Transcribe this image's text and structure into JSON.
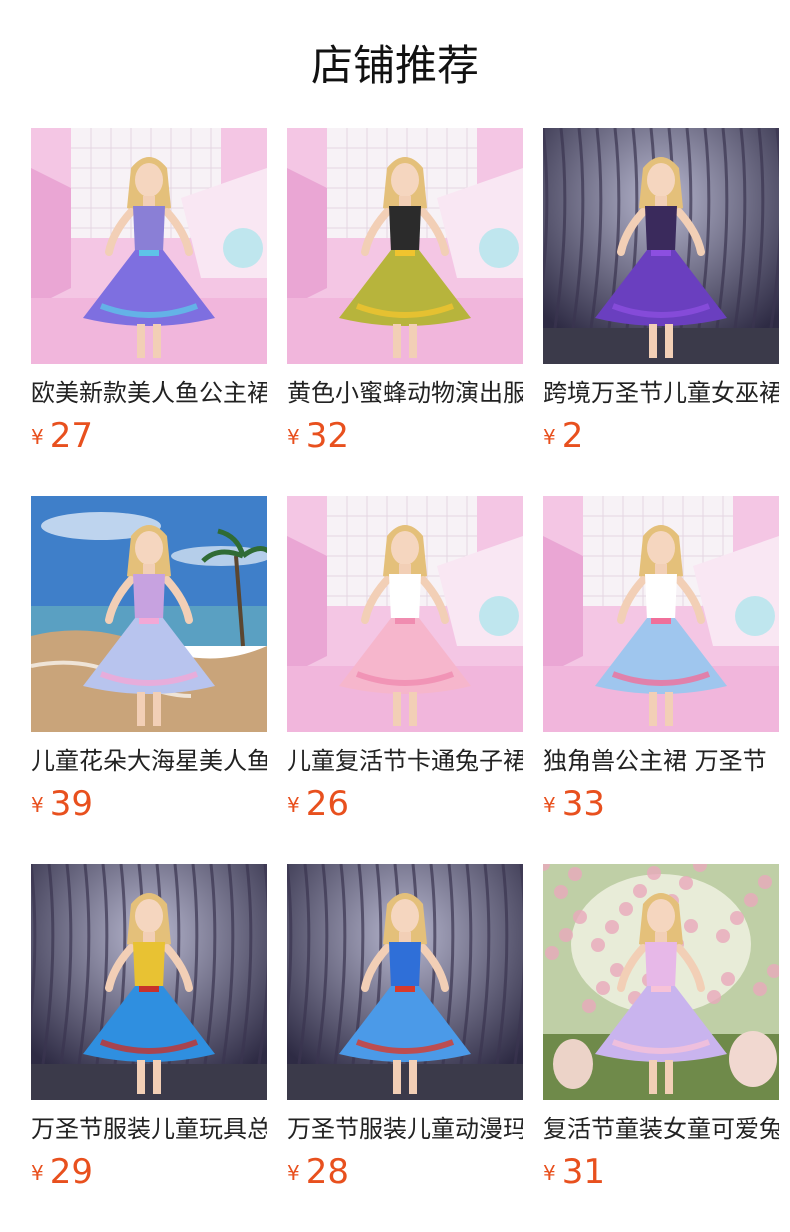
{
  "section_title": "店铺推荐",
  "products": [
    {
      "name": "欧美新款美人鱼公主裙",
      "currency": "¥",
      "price": "27",
      "image": "mermaid-princess-dress",
      "bg": "pink-studio",
      "dress_top": "#8a7fd6",
      "dress_skirt": "#7e6fe0",
      "accent": "#5ec3e8"
    },
    {
      "name": "黄色小蜜蜂动物演出服",
      "currency": "¥",
      "price": "32",
      "image": "bee-costume-dress",
      "bg": "pink-studio",
      "dress_top": "#2b2b2b",
      "dress_skirt": "#b7b43c",
      "accent": "#f0c42e"
    },
    {
      "name": "跨境万圣节儿童女巫裙",
      "currency": "¥",
      "price": "2",
      "image": "witch-dress",
      "bg": "dark-forest",
      "dress_top": "#3a2a5c",
      "dress_skirt": "#6a3fbf",
      "accent": "#8c4fe0"
    },
    {
      "name": "儿童花朵大海星美人鱼裙",
      "currency": "¥",
      "price": "39",
      "image": "starfish-mermaid-dress",
      "bg": "beach",
      "dress_top": "#c7a2e0",
      "dress_skirt": "#b8c4ee",
      "accent": "#f3a8d6"
    },
    {
      "name": "儿童复活节卡通兔子裙",
      "currency": "¥",
      "price": "26",
      "image": "easter-bunny-dress",
      "bg": "pink-studio",
      "dress_top": "#ffffff",
      "dress_skirt": "#f6b6cc",
      "accent": "#f08cb0"
    },
    {
      "name": "独角兽公主裙 万圣节",
      "currency": "¥",
      "price": "33",
      "image": "unicorn-dress",
      "bg": "pink-studio",
      "dress_top": "#ffffff",
      "dress_skirt": "#9fc6ee",
      "accent": "#f06f9a"
    },
    {
      "name": "万圣节服装儿童玩具总动员",
      "currency": "¥",
      "price": "29",
      "image": "cowgirl-dress",
      "bg": "dark-forest",
      "dress_top": "#e8c233",
      "dress_skirt": "#2f8fe0",
      "accent": "#c7312b"
    },
    {
      "name": "万圣节服装儿童动漫玛丽",
      "currency": "¥",
      "price": "28",
      "image": "mario-dress",
      "bg": "dark-forest",
      "dress_top": "#2f6fd8",
      "dress_skirt": "#4b9ae8",
      "accent": "#d83a2b"
    },
    {
      "name": "复活节童装女童可爱兔子",
      "currency": "¥",
      "price": "31",
      "image": "easter-garden-dress",
      "bg": "garden",
      "dress_top": "#e7b8e8",
      "dress_skirt": "#c9b4ee",
      "accent": "#f7c2d8"
    }
  ]
}
